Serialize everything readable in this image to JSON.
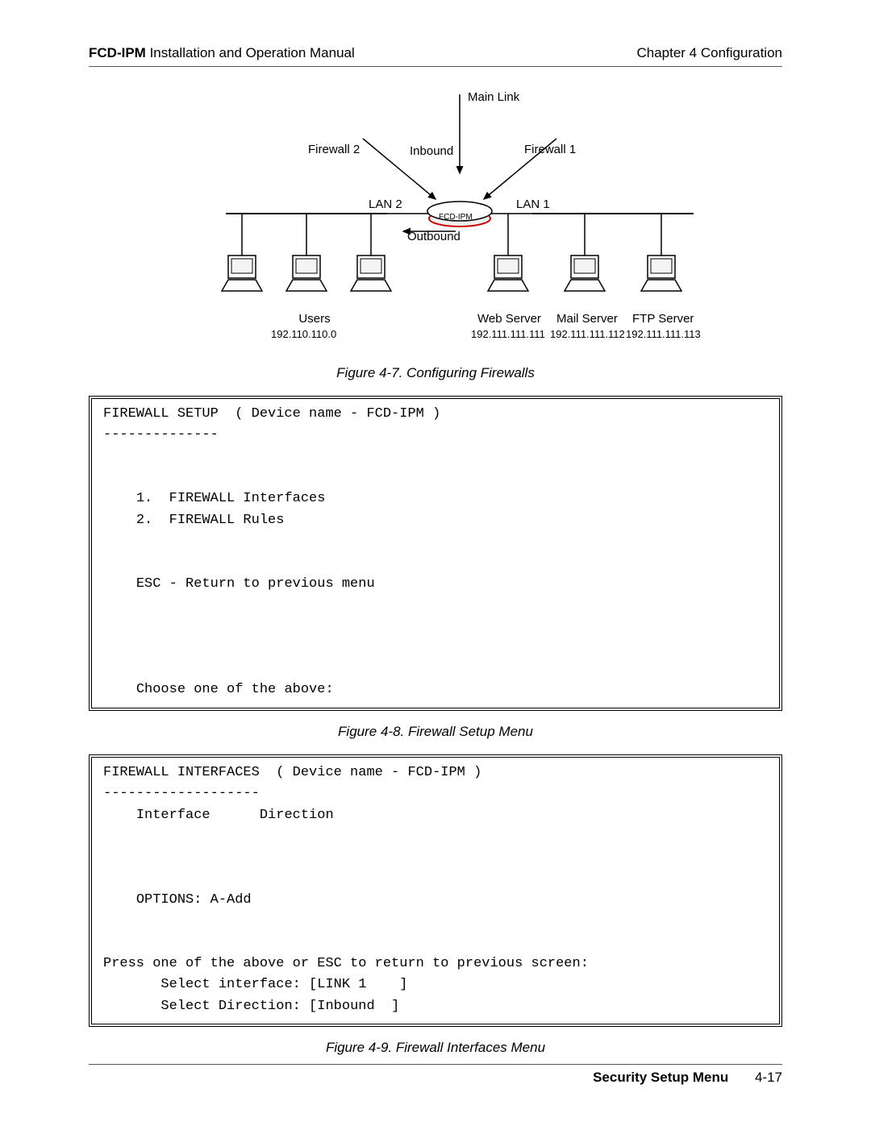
{
  "header": {
    "product": "FCD-IPM",
    "doc_title": "Installation and Operation Manual",
    "chapter": "Chapter 4  Configuration"
  },
  "diagram": {
    "main_link": "Main Link",
    "firewall1": "Firewall 1",
    "firewall2": "Firewall 2",
    "inbound": "Inbound",
    "outbound": "Outbound",
    "lan1": "LAN 1",
    "lan2": "LAN 2",
    "device": "FCD-IPM",
    "users_label": "Users",
    "users_ip": "192.110.110.0",
    "web_label": "Web Server",
    "web_ip": "192.111.111.111",
    "mail_label": "Mail Server",
    "mail_ip": "192.111.111.112",
    "ftp_label": "FTP Server",
    "ftp_ip": "192.111.111.113"
  },
  "captions": {
    "fig7": "Figure 4-7.  Configuring Firewalls",
    "fig8": "Figure 4-8.  Firewall Setup Menu",
    "fig9": "Figure 4-9.  Firewall Interfaces Menu"
  },
  "term1": {
    "title": "FIREWALL SETUP  ( Device name - FCD-IPM )",
    "divider": "--------------",
    "item1": "1.  FIREWALL Interfaces",
    "item2": "2.  FIREWALL Rules",
    "esc": "ESC - Return to previous menu",
    "prompt": "Choose one of the above:"
  },
  "term2": {
    "title": "FIREWALL INTERFACES  ( Device name - FCD-IPM )",
    "divider": "-------------------",
    "cols": "Interface      Direction",
    "options": "OPTIONS: A-Add",
    "press": "Press one of the above or ESC to return to previous screen:",
    "sel_if_label": "Select interface: [",
    "sel_if_value": "LINK 1    ",
    "sel_if_close": "]",
    "sel_dir_label": "Select Direction: [",
    "sel_dir_value": "Inbound  ",
    "sel_dir_close": "]"
  },
  "footer": {
    "section": "Security Setup Menu",
    "page": "4-17"
  }
}
